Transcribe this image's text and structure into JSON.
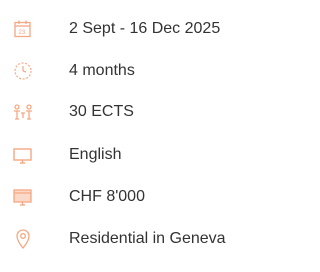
{
  "accent_color": "#f5a882",
  "items": [
    {
      "icon": "calendar-icon",
      "label": "2 Sept - 16 Dec 2025"
    },
    {
      "icon": "clock-icon",
      "label": "4 months"
    },
    {
      "icon": "people-icon",
      "label": "30 ECTS"
    },
    {
      "icon": "monitor-icon",
      "label": "English"
    },
    {
      "icon": "screen-money-icon",
      "label": "CHF 8'000"
    },
    {
      "icon": "location-pin-icon",
      "label": "Residential in Geneva"
    }
  ]
}
